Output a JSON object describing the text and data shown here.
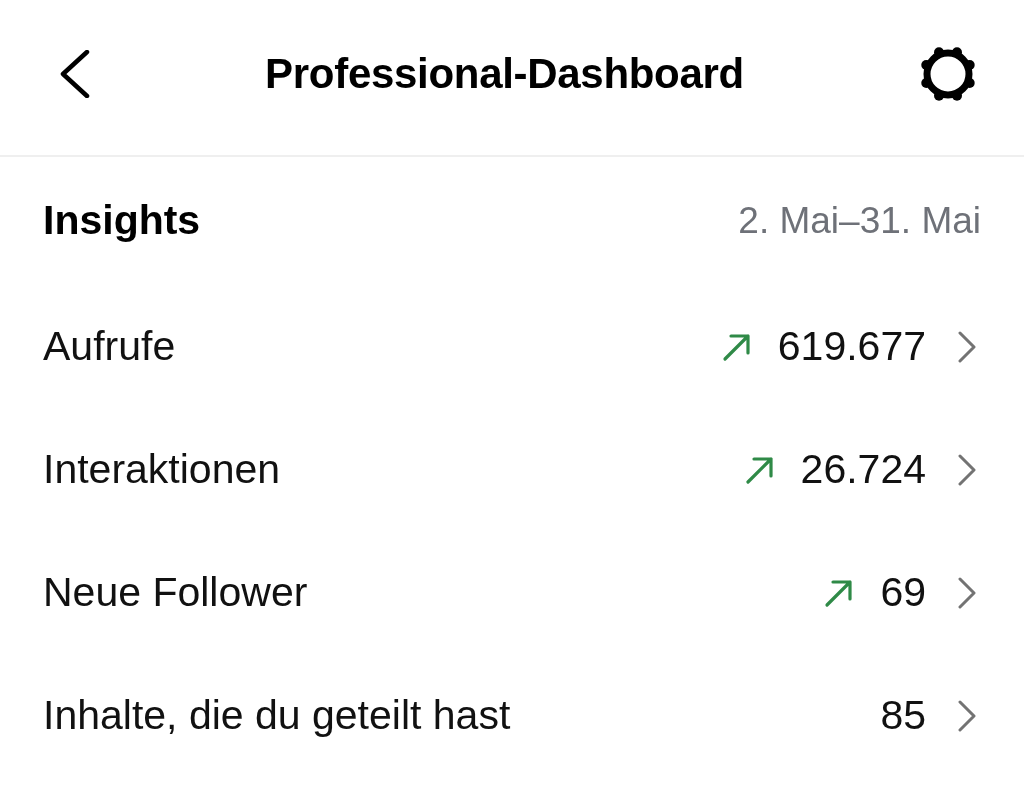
{
  "header": {
    "title": "Professional-Dashboard"
  },
  "insights": {
    "title": "Insights",
    "date_range": "2. Mai–31. Mai"
  },
  "metrics": [
    {
      "label": "Aufrufe",
      "value": "619.677",
      "trending_up": true
    },
    {
      "label": "Interaktionen",
      "value": "26.724",
      "trending_up": true
    },
    {
      "label": "Neue Follower",
      "value": "69",
      "trending_up": true
    },
    {
      "label": "Inhalte, die du geteilt hast",
      "value": "85",
      "trending_up": false
    }
  ]
}
